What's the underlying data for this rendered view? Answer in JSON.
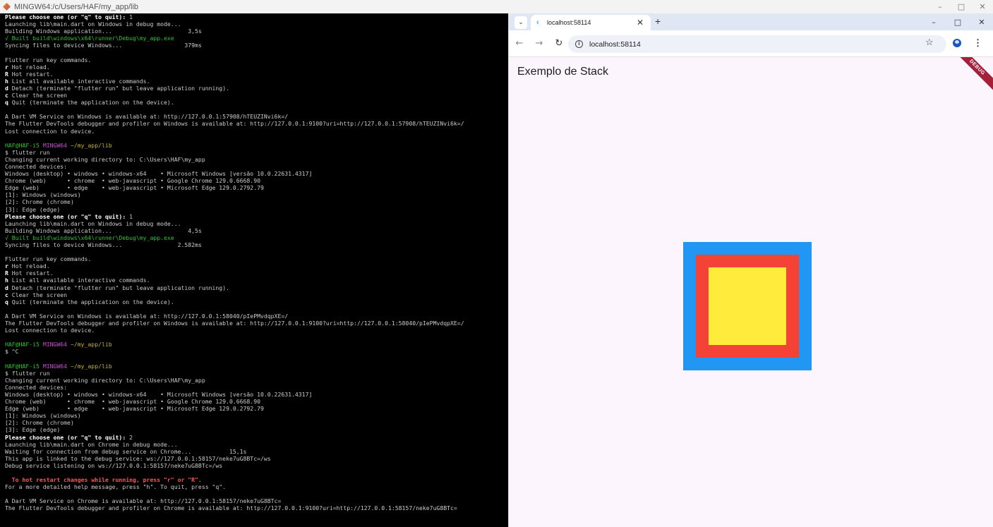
{
  "terminal_window": {
    "title": "MINGW64:/c/Users/HAF/my_app/lib",
    "controls": [
      "–",
      "□",
      "✕"
    ]
  },
  "terminal_lines": [
    [
      [
        "Please choose one (or \"q\" to quit): ",
        "b"
      ],
      [
        "1",
        ""
      ]
    ],
    [
      [
        "Launching lib\\main.dart on Windows in debug mode...",
        ""
      ]
    ],
    [
      [
        "Building Windows application...                      3,5s",
        ""
      ]
    ],
    [
      [
        "√ Built build\\windows\\x64\\runner\\Debug\\my_app.exe",
        "g"
      ]
    ],
    [
      [
        "Syncing files to device Windows...                  379ms",
        ""
      ]
    ],
    [
      [
        "",
        ""
      ]
    ],
    [
      [
        "Flutter run key commands.",
        ""
      ]
    ],
    [
      [
        "r",
        "b"
      ],
      [
        " Hot reload.",
        ""
      ]
    ],
    [
      [
        "R",
        "b"
      ],
      [
        " Hot restart.",
        ""
      ]
    ],
    [
      [
        "h",
        "b"
      ],
      [
        " List all available interactive commands.",
        ""
      ]
    ],
    [
      [
        "d",
        "b"
      ],
      [
        " Detach (terminate \"flutter run\" but leave application running).",
        ""
      ]
    ],
    [
      [
        "c",
        "b"
      ],
      [
        " Clear the screen",
        ""
      ]
    ],
    [
      [
        "q",
        "b"
      ],
      [
        " Quit (terminate the application on the device).",
        ""
      ]
    ],
    [
      [
        "",
        ""
      ]
    ],
    [
      [
        "A Dart VM Service on Windows is available at: http://127.0.0.1:57908/hTEUZINvi6k=/",
        ""
      ]
    ],
    [
      [
        "The Flutter DevTools debugger and profiler on Windows is available at: http://127.0.0.1:9100?uri=http://127.0.0.1:57908/hTEUZINvi6k=/",
        ""
      ]
    ],
    [
      [
        "Lost connection to device.",
        ""
      ]
    ],
    [
      [
        "",
        ""
      ]
    ],
    [
      [
        "HAF@HAF-i5 ",
        "g"
      ],
      [
        "MINGW64 ",
        "p"
      ],
      [
        "~/my_app/lib",
        "y"
      ]
    ],
    [
      [
        "$ flutter run",
        ""
      ]
    ],
    [
      [
        "Changing current working directory to: C:\\Users\\HAF\\my_app",
        ""
      ]
    ],
    [
      [
        "Connected devices:",
        ""
      ]
    ],
    [
      [
        "Windows (desktop) • windows • windows-x64    • Microsoft Windows [versão 10.0.22631.4317]",
        ""
      ]
    ],
    [
      [
        "Chrome (web)      • chrome  • web-javascript • Google Chrome 129.0.6668.90",
        ""
      ]
    ],
    [
      [
        "Edge (web)        • edge    • web-javascript • Microsoft Edge 129.0.2792.79",
        ""
      ]
    ],
    [
      [
        "[1]: Windows (windows)",
        ""
      ]
    ],
    [
      [
        "[2]: Chrome (chrome)",
        ""
      ]
    ],
    [
      [
        "[3]: Edge (edge)",
        ""
      ]
    ],
    [
      [
        "Please choose one (or \"q\" to quit): ",
        "b"
      ],
      [
        "1",
        ""
      ]
    ],
    [
      [
        "Launching lib\\main.dart on Windows in debug mode...",
        ""
      ]
    ],
    [
      [
        "Building Windows application...                      4,5s",
        ""
      ]
    ],
    [
      [
        "√ Built build\\windows\\x64\\runner\\Debug\\my_app.exe",
        "g"
      ]
    ],
    [
      [
        "Syncing files to device Windows...                2.582ms",
        ""
      ]
    ],
    [
      [
        "",
        ""
      ]
    ],
    [
      [
        "Flutter run key commands.",
        ""
      ]
    ],
    [
      [
        "r",
        "b"
      ],
      [
        " Hot reload.",
        ""
      ]
    ],
    [
      [
        "R",
        "b"
      ],
      [
        " Hot restart.",
        ""
      ]
    ],
    [
      [
        "h",
        "b"
      ],
      [
        " List all available interactive commands.",
        ""
      ]
    ],
    [
      [
        "d",
        "b"
      ],
      [
        " Detach (terminate \"flutter run\" but leave application running).",
        ""
      ]
    ],
    [
      [
        "c",
        "b"
      ],
      [
        " Clear the screen",
        ""
      ]
    ],
    [
      [
        "q",
        "b"
      ],
      [
        " Quit (terminate the application on the device).",
        ""
      ]
    ],
    [
      [
        "",
        ""
      ]
    ],
    [
      [
        "A Dart VM Service on Windows is available at: http://127.0.0.1:58040/pIePMvdqpXE=/",
        ""
      ]
    ],
    [
      [
        "The Flutter DevTools debugger and profiler on Windows is available at: http://127.0.0.1:9100?uri=http://127.0.0.1:58040/pIePMvdqpXE=/",
        ""
      ]
    ],
    [
      [
        "Lost connection to device.",
        ""
      ]
    ],
    [
      [
        "",
        ""
      ]
    ],
    [
      [
        "HAF@HAF-i5 ",
        "g"
      ],
      [
        "MINGW64 ",
        "p"
      ],
      [
        "~/my_app/lib",
        "y"
      ]
    ],
    [
      [
        "$ ^C",
        ""
      ]
    ],
    [
      [
        "",
        ""
      ]
    ],
    [
      [
        "HAF@HAF-i5 ",
        "g"
      ],
      [
        "MINGW64 ",
        "p"
      ],
      [
        "~/my_app/lib",
        "y"
      ]
    ],
    [
      [
        "$ flutter run",
        ""
      ]
    ],
    [
      [
        "Changing current working directory to: C:\\Users\\HAF\\my_app",
        ""
      ]
    ],
    [
      [
        "Connected devices:",
        ""
      ]
    ],
    [
      [
        "Windows (desktop) • windows • windows-x64    • Microsoft Windows [versão 10.0.22631.4317]",
        ""
      ]
    ],
    [
      [
        "Chrome (web)      • chrome  • web-javascript • Google Chrome 129.0.6668.90",
        ""
      ]
    ],
    [
      [
        "Edge (web)        • edge    • web-javascript • Microsoft Edge 129.0.2792.79",
        ""
      ]
    ],
    [
      [
        "[1]: Windows (windows)",
        ""
      ]
    ],
    [
      [
        "[2]: Chrome (chrome)",
        ""
      ]
    ],
    [
      [
        "[3]: Edge (edge)",
        ""
      ]
    ],
    [
      [
        "Please choose one (or \"q\" to quit): ",
        "b"
      ],
      [
        "2",
        ""
      ]
    ],
    [
      [
        "Launching lib\\main.dart on Chrome in debug mode...",
        ""
      ]
    ],
    [
      [
        "Waiting for connection from debug service on Chrome...           15,1s",
        ""
      ]
    ],
    [
      [
        "This app is linked to the debug service: ws://127.0.0.1:58157/neke7uG8BTc=/ws",
        ""
      ]
    ],
    [
      [
        "Debug service listening on ws://127.0.0.1:58157/neke7uG8BTc=/ws",
        ""
      ]
    ],
    [
      [
        "",
        ""
      ]
    ],
    [
      [
        "  To hot restart changes while running, press \"r\" or \"R\".",
        "r"
      ]
    ],
    [
      [
        "For a more detailed help message, press \"h\". To quit, press \"q\".",
        ""
      ]
    ],
    [
      [
        "",
        ""
      ]
    ],
    [
      [
        "A Dart VM Service on Chrome is available at: http://127.0.0.1:58157/neke7uG8BTc=",
        ""
      ]
    ],
    [
      [
        "The Flutter DevTools debugger and profiler on Chrome is available at: http://127.0.0.1:9100?uri=http://127.0.0.1:58157/neke7uG8BTc=",
        ""
      ]
    ]
  ],
  "browser": {
    "tab_menu_icon": "⌄",
    "tab_title": "localhost:58114",
    "tab_close": "✕",
    "new_tab": "+",
    "controls": [
      "–",
      "□",
      "✕"
    ],
    "back": "←",
    "forward": "→",
    "reload": "↻",
    "url": "localhost:58114",
    "bookmark": "☆",
    "menu": "⋮"
  },
  "app": {
    "title": "Exemplo de Stack",
    "debug_banner": "DEBUG",
    "colors": {
      "outer": "#2196f3",
      "middle": "#f44336",
      "inner": "#ffeb3b"
    }
  }
}
